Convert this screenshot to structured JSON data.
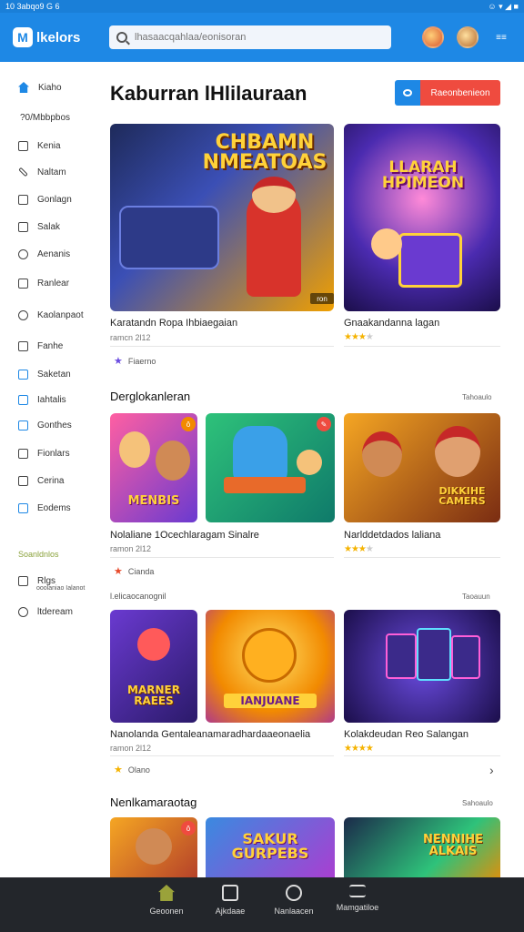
{
  "status": {
    "left": "10 3abqo9 G 6",
    "right": "☺ ▾ ◢ ■"
  },
  "app": {
    "name": "lkelors",
    "logo_mark": "M"
  },
  "search": {
    "placeholder": "lhasaacqahlaa/eonisoran"
  },
  "header": {
    "menu_label": "≡≡"
  },
  "sidebar": {
    "items": [
      {
        "label": "Kiaho",
        "icon": "home-icon"
      },
      {
        "label": "?0/Mbbpbos",
        "icon": ""
      },
      {
        "label": "Kenia",
        "icon": "house-outline-icon"
      },
      {
        "label": "Naltam",
        "icon": "pencil-icon"
      },
      {
        "label": "Gonlagn",
        "icon": "grid-icon"
      },
      {
        "label": "Salak",
        "icon": "chat-icon"
      },
      {
        "label": "Aenanis",
        "icon": "clock-icon"
      },
      {
        "label": "Ranlear",
        "icon": "plus-box-icon"
      },
      {
        "label": "Kaolanpaot",
        "icon": "face-icon"
      },
      {
        "label": "Fanhe",
        "icon": "flag-icon"
      },
      {
        "label": "Saketan",
        "icon": "box-icon"
      },
      {
        "label": "Iahtalis",
        "icon": "b-box-icon"
      },
      {
        "label": "Gonthes",
        "icon": "image-icon"
      },
      {
        "label": "Fionlars",
        "icon": "envelope-icon"
      },
      {
        "label": "Cerina",
        "icon": "tag-icon"
      },
      {
        "label": "Eodems",
        "icon": "g-box-icon"
      }
    ],
    "heading": "Soanldnlos",
    "sub_items": [
      {
        "label": "Rlgs",
        "sub": "ooolaniao Ialanot"
      },
      {
        "label": "ltdeream"
      }
    ]
  },
  "main": {
    "title": "Kaburran lHlilauraan",
    "cta_label": "Raeonbenieon",
    "featured": [
      {
        "title": "Karatandn Ropa Ihbiaegaian",
        "meta": "ramcn 2l12",
        "art": "CHBAMN\nNMEATOAS",
        "stars": 0,
        "tag": "Fiaerno",
        "badge": "ron"
      },
      {
        "title": "Gnaakandanna lagan",
        "meta": "",
        "art": "LLARAH\nHPIMEON",
        "stars": 3,
        "tag": ""
      }
    ],
    "sections": [
      {
        "title": "Derglokanleran",
        "link": "Tahoaulo",
        "cards": [
          {
            "art": "MENBIS",
            "badge": "ô"
          },
          {
            "art": "",
            "badge": "✎"
          },
          {
            "art": "DIKKIHE\nCAMERS",
            "badge": ""
          }
        ],
        "left_title": "Nolaliane 1Ocechlaragam Sinalre",
        "left_meta": "ramon 2l12",
        "left_tag": "Cianda",
        "right_title": "Narlddetdados laliana",
        "right_stars": 3
      },
      {
        "title": "l.elicaocanognil",
        "link": "Taoauun",
        "cards": [
          {
            "art": "MARNER\nRAEES",
            "badge": ""
          },
          {
            "art": "IANJUANE",
            "badge": ""
          },
          {
            "art": "",
            "badge": ""
          }
        ],
        "left_title": "Nanolanda Gentaleanamarad​hardaaeonaelia",
        "left_meta": "ramon 2l12",
        "left_tag": "Olano",
        "right_title": "Kolakdeudan Reo Salangan",
        "right_stars": 4
      },
      {
        "title": "Nenlkamaraotag",
        "link": "Sahoaulo",
        "cards": [
          {
            "art": "",
            "badge": "ô"
          },
          {
            "art": "SAKUR\nGURPEBS",
            "badge": ""
          },
          {
            "art": "NENNIHE\nALKAIS",
            "badge": ""
          }
        ]
      }
    ]
  },
  "bottom_nav": [
    {
      "label": "Geoonen",
      "icon": "home-icon"
    },
    {
      "label": "Ajkdaae",
      "icon": "download-icon"
    },
    {
      "label": "Nanlaacen",
      "icon": "clock-icon"
    },
    {
      "label": "Mamgatiloe",
      "icon": "menu-icon"
    }
  ]
}
